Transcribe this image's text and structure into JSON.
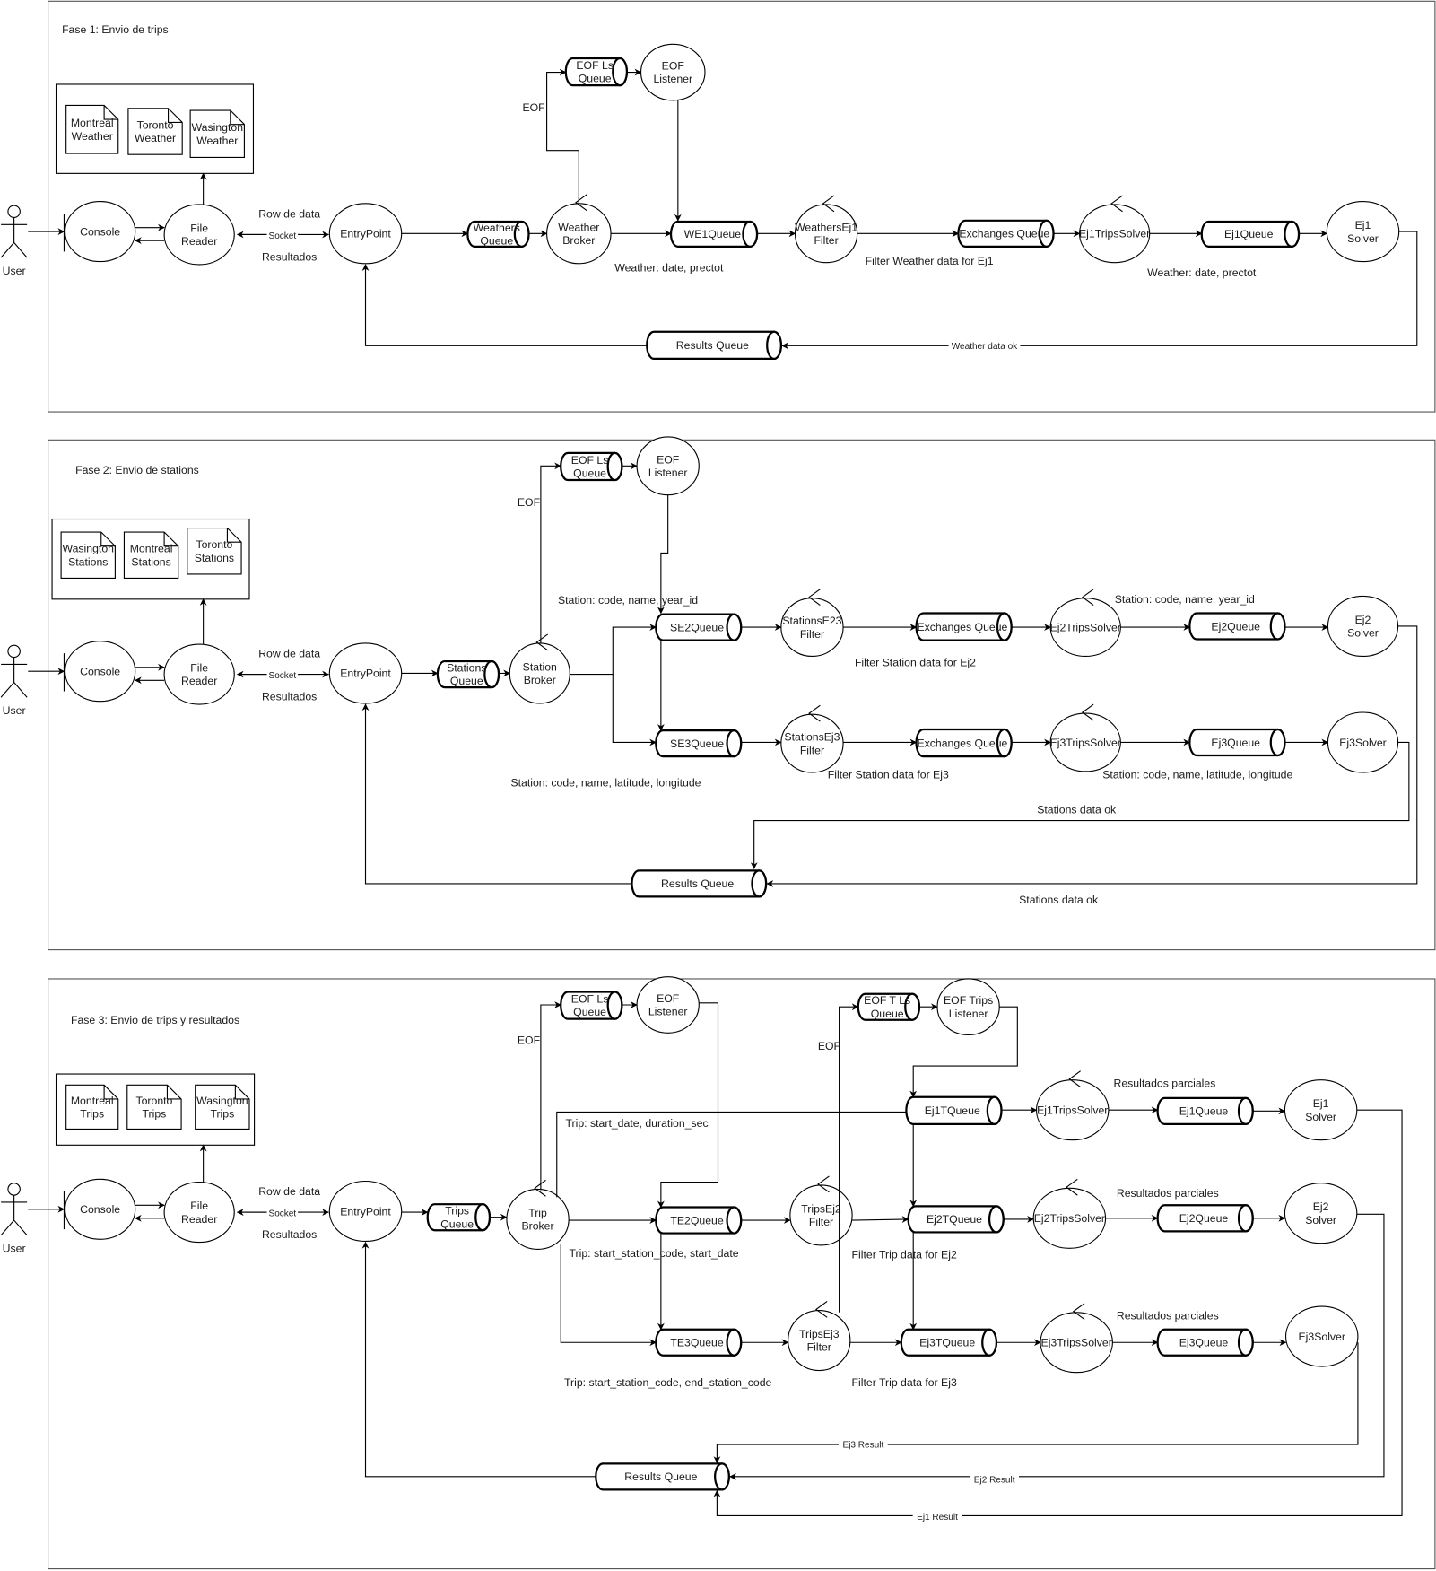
{
  "phase1": {
    "title": "Fase 1: Envio de trips",
    "user": [
      "User"
    ],
    "console": [
      "Console"
    ],
    "file_reader": [
      "File",
      "Reader"
    ],
    "files": [
      [
        "Montreal",
        "Weather"
      ],
      [
        "Toronto",
        "Weather"
      ],
      [
        "Wasington",
        "Weather"
      ]
    ],
    "row_de_data": [
      "Row de data"
    ],
    "socket": [
      "Socket"
    ],
    "resultados": [
      "Resultados"
    ],
    "entry_point": [
      "EntryPoint"
    ],
    "source_queue": [
      "Weathers",
      "Queue"
    ],
    "broker": [
      "Weather",
      "Broker"
    ],
    "eof_queue": [
      "EOF Ls",
      "Queue"
    ],
    "eof_listener": [
      "EOF",
      "Listener"
    ],
    "eof": [
      "EOF"
    ],
    "we1_queue": [
      "WE1Queue"
    ],
    "we1_label": [
      "Weather: date, prectot"
    ],
    "filter": [
      "WeathersEj1",
      "Filter"
    ],
    "exchanges_queue": [
      "Exchanges Queue"
    ],
    "filter_label": [
      "Filter Weather data for Ej1"
    ],
    "trips_solver": [
      "Ej1TripsSolver"
    ],
    "ej1_queue": [
      "Ej1Queue"
    ],
    "ej1_label": [
      "Weather: date, prectot"
    ],
    "solver": [
      "Ej1",
      "Solver"
    ],
    "results_queue": [
      "Results Queue"
    ],
    "return_label": [
      "Weather data ok"
    ]
  },
  "phase2": {
    "title": "Fase 2: Envio de stations",
    "user": [
      "User"
    ],
    "console": [
      "Console"
    ],
    "file_reader": [
      "File",
      "Reader"
    ],
    "files": [
      [
        "Wasington",
        "Stations"
      ],
      [
        "Montreal",
        "Stations"
      ],
      [
        "Toronto",
        "Stations"
      ]
    ],
    "row_de_data": [
      "Row de data"
    ],
    "socket": [
      "Socket"
    ],
    "resultados": [
      "Resultados"
    ],
    "entry_point": [
      "EntryPoint"
    ],
    "source_queue": [
      "Stations",
      "Queue"
    ],
    "broker": [
      "Station",
      "Broker"
    ],
    "eof_queue": [
      "EOF Ls",
      "Queue"
    ],
    "eof_listener": [
      "EOF",
      "Listener"
    ],
    "eof": [
      "EOF"
    ],
    "se2_queue": [
      "SE2Queue"
    ],
    "se3_queue": [
      "SE3Queue"
    ],
    "se2_label": [
      "Station: code, name, year_id"
    ],
    "se3_label": [
      "Station: code, name, latitude, longitude"
    ],
    "filter_ej2": [
      "StationsE23",
      "Filter"
    ],
    "filter_ej3": [
      "StationsEj3",
      "Filter"
    ],
    "exchanges_queue_ej2": [
      "Exchanges Queue"
    ],
    "exchanges_queue_ej3": [
      "Exchanges Queue"
    ],
    "filter_label_ej2": [
      "Filter Station data for Ej2"
    ],
    "filter_label_ej3": [
      "Filter Station data for Ej3"
    ],
    "trips_solver_ej2": [
      "Ej2TripsSolver"
    ],
    "trips_solver_ej3": [
      "Ej3TripsSolver"
    ],
    "ej2_queue": [
      "Ej2Queue"
    ],
    "ej3_queue": [
      "Ej3Queue"
    ],
    "ej2_label": [
      "Station: code, name, year_id"
    ],
    "ej3_label": [
      "Station: code, name, latitude, longitude"
    ],
    "solver_ej2": [
      "Ej2",
      "Solver"
    ],
    "solver_ej3": [
      "Ej3Solver"
    ],
    "results_queue": [
      "Results Queue"
    ],
    "return_label_ej3": [
      "Stations data ok"
    ],
    "return_label_ej2": [
      "Stations data ok"
    ]
  },
  "phase3": {
    "title": "Fase 3: Envio de trips y resultados",
    "user": [
      "User"
    ],
    "console": [
      "Console"
    ],
    "file_reader": [
      "File",
      "Reader"
    ],
    "files": [
      [
        "Montreal",
        "Trips"
      ],
      [
        "Toronto",
        "Trips"
      ],
      [
        "Wasington",
        "Trips"
      ]
    ],
    "row_de_data": [
      "Row de data"
    ],
    "socket": [
      "Socket"
    ],
    "resultados": [
      "Resultados"
    ],
    "entry_point": [
      "EntryPoint"
    ],
    "source_queue": [
      "Trips",
      "Queue"
    ],
    "broker": [
      "Trip",
      "Broker"
    ],
    "eof_queue": [
      "EOF Ls",
      "Queue"
    ],
    "eof_listener": [
      "EOF",
      "Listener"
    ],
    "eof": [
      "EOF"
    ],
    "eof_t_queue": [
      "EOF T Ls",
      "Queue"
    ],
    "eof_trips_listener": [
      "EOF Trips",
      "Listener"
    ],
    "eof_t": [
      "EOF"
    ],
    "trip_ej1_label": [
      "Trip: start_date, duration_sec"
    ],
    "te2_queue": [
      "TE2Queue"
    ],
    "te3_queue": [
      "TE3Queue"
    ],
    "te2_label": [
      "Trip: start_station_code, start_date"
    ],
    "te3_label": [
      "Trip: start_station_code, end_station_code"
    ],
    "filter_ej2": [
      "TripsEj2",
      "Filter"
    ],
    "filter_ej3": [
      "TripsEj3",
      "Filter"
    ],
    "filter_label_ej2": [
      "Filter Trip data for Ej2"
    ],
    "filter_label_ej3": [
      "Filter Trip data for Ej3"
    ],
    "ej1t_queue": [
      "Ej1TQueue"
    ],
    "ej2t_queue": [
      "Ej2TQueue"
    ],
    "ej3t_queue": [
      "Ej3TQueue"
    ],
    "trips_solver_ej1": [
      "Ej1TripsSolver"
    ],
    "trips_solver_ej2": [
      "Ej2TripsSolver"
    ],
    "trips_solver_ej3": [
      "Ej3TripsSolver"
    ],
    "partial_ej1": [
      "Resultados parciales"
    ],
    "partial_ej2": [
      "Resultados parciales"
    ],
    "partial_ej3": [
      "Resultados parciales"
    ],
    "ej1_queue": [
      "Ej1Queue"
    ],
    "ej2_queue": [
      "Ej2Queue"
    ],
    "ej3_queue": [
      "Ej3Queue"
    ],
    "solver_ej1": [
      "Ej1",
      "Solver"
    ],
    "solver_ej2": [
      "Ej2",
      "Solver"
    ],
    "solver_ej3": [
      "Ej3Solver"
    ],
    "results_queue": [
      "Results Queue"
    ],
    "ej3_result": [
      "Ej3 Result"
    ],
    "ej2_result": [
      "Ej2 Result"
    ],
    "ej1_result": [
      "Ej1 Result"
    ]
  }
}
